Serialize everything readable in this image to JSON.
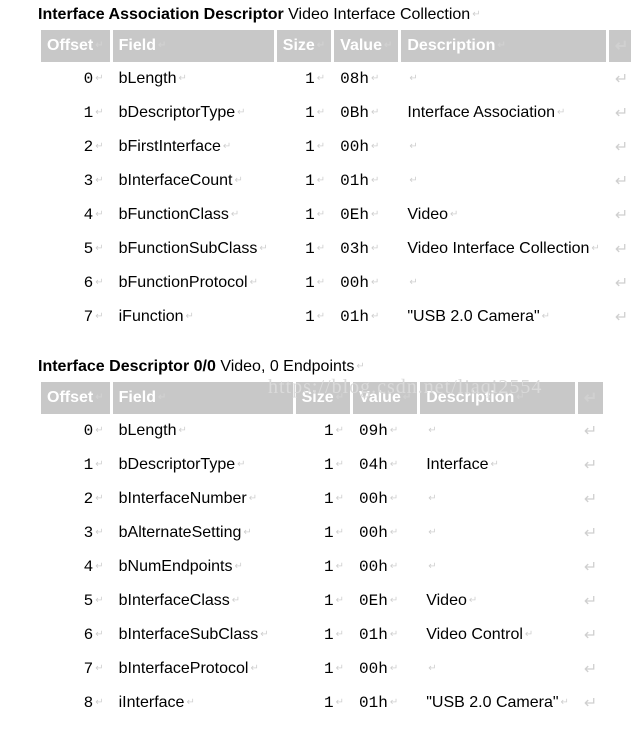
{
  "pilcrow": "↵",
  "headers": [
    "Offset",
    "Field",
    "Size",
    "Value",
    "Description"
  ],
  "watermark_text": "https://blog.csdn.net/liaqi2554",
  "table1": {
    "title_bold": "Interface Association Descriptor",
    "title_sub": "Video Interface Collection",
    "rows": [
      {
        "offset": "0",
        "field": "bLength",
        "size": "1",
        "value": "08h",
        "desc": ""
      },
      {
        "offset": "1",
        "field": "bDescriptorType",
        "size": "1",
        "value": "0Bh",
        "desc": "Interface Association"
      },
      {
        "offset": "2",
        "field": "bFirstInterface",
        "size": "1",
        "value": "00h",
        "desc": ""
      },
      {
        "offset": "3",
        "field": "bInterfaceCount",
        "size": "1",
        "value": "01h",
        "desc": ""
      },
      {
        "offset": "4",
        "field": "bFunctionClass",
        "size": "1",
        "value": "0Eh",
        "desc": "Video"
      },
      {
        "offset": "5",
        "field": "bFunctionSubClass",
        "size": "1",
        "value": "03h",
        "desc": "Video Interface Collection"
      },
      {
        "offset": "6",
        "field": "bFunctionProtocol",
        "size": "1",
        "value": "00h",
        "desc": ""
      },
      {
        "offset": "7",
        "field": "iFunction",
        "size": "1",
        "value": "01h",
        "desc": "\"USB 2.0 Camera\""
      }
    ]
  },
  "table2": {
    "title_bold": "Interface Descriptor 0/0",
    "title_sub": "Video, 0 Endpoints",
    "rows": [
      {
        "offset": "0",
        "field": "bLength",
        "size": "1",
        "value": "09h",
        "desc": ""
      },
      {
        "offset": "1",
        "field": "bDescriptorType",
        "size": "1",
        "value": "04h",
        "desc": "Interface"
      },
      {
        "offset": "2",
        "field": "bInterfaceNumber",
        "size": "1",
        "value": "00h",
        "desc": ""
      },
      {
        "offset": "3",
        "field": "bAlternateSetting",
        "size": "1",
        "value": "00h",
        "desc": ""
      },
      {
        "offset": "4",
        "field": "bNumEndpoints",
        "size": "1",
        "value": "00h",
        "desc": ""
      },
      {
        "offset": "5",
        "field": "bInterfaceClass",
        "size": "1",
        "value": "0Eh",
        "desc": "Video"
      },
      {
        "offset": "6",
        "field": "bInterfaceSubClass",
        "size": "1",
        "value": "01h",
        "desc": "Video Control"
      },
      {
        "offset": "7",
        "field": "bInterfaceProtocol",
        "size": "1",
        "value": "00h",
        "desc": ""
      },
      {
        "offset": "8",
        "field": "iInterface",
        "size": "1",
        "value": "01h",
        "desc": "\"USB 2.0 Camera\""
      }
    ]
  }
}
